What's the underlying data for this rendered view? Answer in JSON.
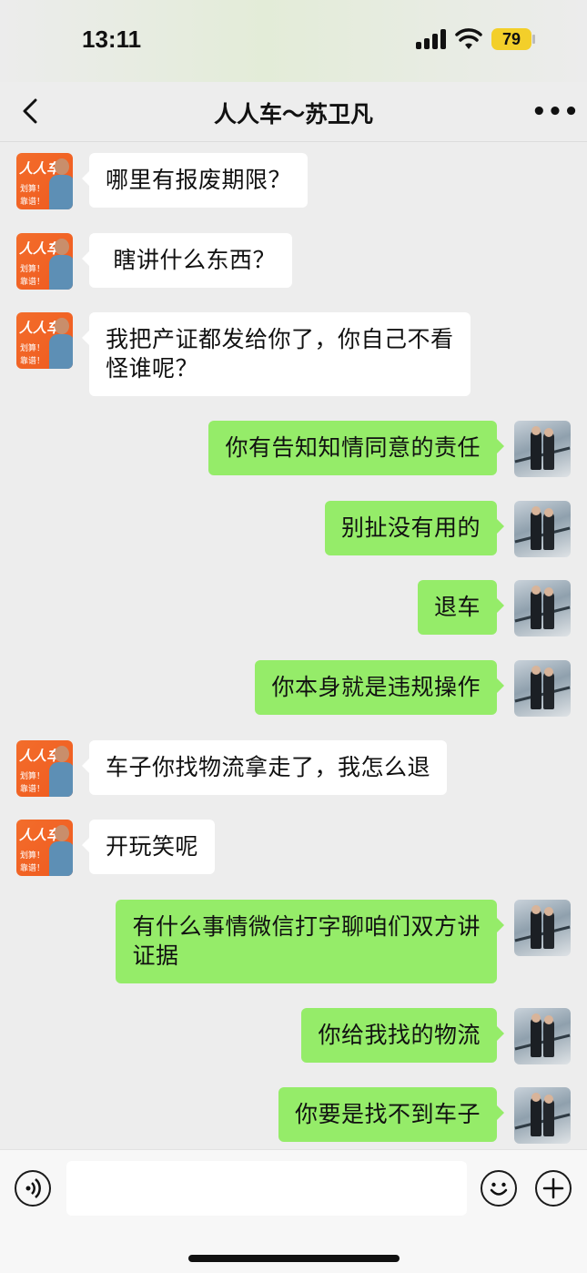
{
  "status_bar": {
    "time": "13:11",
    "battery": "79"
  },
  "header": {
    "title": "人人车～苏卫凡"
  },
  "brand_avatar": {
    "brand": "人人车",
    "line1": "划算！",
    "line2": "靠谱！"
  },
  "messages": [
    {
      "side": "left",
      "text": "哪里有报废期限？"
    },
    {
      "side": "left",
      "text": " 瞎讲什么东西？"
    },
    {
      "side": "left",
      "text": "我把产证都发给你了，你自己不看\n怪谁呢？"
    },
    {
      "side": "right",
      "text": "你有告知知情同意的责任"
    },
    {
      "side": "right",
      "text": "别扯没有用的"
    },
    {
      "side": "right",
      "text": "退车"
    },
    {
      "side": "right",
      "text": "你本身就是违规操作"
    },
    {
      "side": "left",
      "text": "车子你找物流拿走了，我怎么退"
    },
    {
      "side": "left",
      "text": "开玩笑呢"
    },
    {
      "side": "right",
      "text": "有什么事情微信打字聊咱们双方讲\n证据"
    },
    {
      "side": "right",
      "text": "你给我找的物流"
    },
    {
      "side": "right",
      "text": "你要是找不到车子"
    }
  ],
  "input": {
    "value": "",
    "placeholder": ""
  },
  "icons": {
    "back": "chevron-left-icon",
    "more": "more-horizontal-icon",
    "voice": "voice-icon",
    "emoji": "emoji-icon",
    "plus": "plus-icon"
  },
  "colors": {
    "outgoing_bubble": "#95ec69",
    "incoming_bubble": "#ffffff",
    "background": "#ededed"
  }
}
